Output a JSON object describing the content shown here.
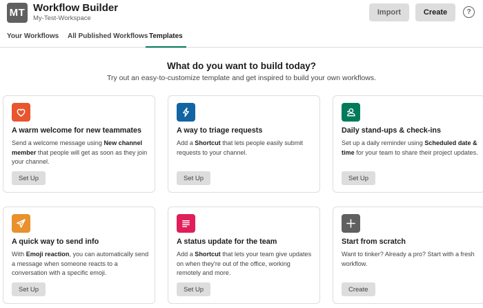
{
  "header": {
    "avatar_text": "MT",
    "title": "Workflow Builder",
    "workspace": "My-Test-Workspace",
    "import_label": "Import",
    "create_label": "Create",
    "help_label": "?"
  },
  "tabs": [
    {
      "label": "Your Workflows"
    },
    {
      "label": "All Published Workflows"
    },
    {
      "label": "Templates",
      "active": true
    }
  ],
  "hero": {
    "title": "What do you want to build today?",
    "subtitle": "Try out an easy-to-customize template and get inspired to build your own workflows."
  },
  "cards": [
    {
      "icon": "heart-icon",
      "icon_color": "#e8552e",
      "title": "A warm welcome for new teammates",
      "desc": [
        {
          "text": "Send a welcome message using "
        },
        {
          "text": "New channel member",
          "bold": true
        },
        {
          "text": " that people will get as soon as they join your channel."
        }
      ],
      "button": "Set Up"
    },
    {
      "icon": "lightning-icon",
      "icon_color": "#1264a3",
      "title": "A way to triage requests",
      "desc": [
        {
          "text": "Add a "
        },
        {
          "text": "Shortcut",
          "bold": true
        },
        {
          "text": " that lets people easily submit requests to your channel."
        }
      ],
      "button": "Set Up"
    },
    {
      "icon": "standup-icon",
      "icon_color": "#007a5a",
      "title": "Daily stand-ups & check-ins",
      "desc": [
        {
          "text": "Set up a daily reminder using "
        },
        {
          "text": "Scheduled date & time",
          "bold": true
        },
        {
          "text": " for your team to share their project updates."
        }
      ],
      "button": "Set Up"
    },
    {
      "icon": "paper-plane-icon",
      "icon_color": "#e8912d",
      "title": "A quick way to send info",
      "desc": [
        {
          "text": "With "
        },
        {
          "text": "Emoji reaction",
          "bold": true
        },
        {
          "text": ", you can automatically send a message when someone reacts to a conversation with a specific emoji."
        }
      ],
      "button": "Set Up"
    },
    {
      "icon": "list-icon",
      "icon_color": "#e01e5a",
      "title": "A status update for the team",
      "desc": [
        {
          "text": "Add a "
        },
        {
          "text": "Shortcut",
          "bold": true
        },
        {
          "text": " that lets your team give updates on when they're out of the office, working remotely and more."
        }
      ],
      "button": "Set Up"
    },
    {
      "icon": "plus-icon",
      "icon_color": "#616061",
      "title": "Start from scratch",
      "desc": [
        {
          "text": "Want to tinker? Already a pro? Start with a fresh workflow."
        }
      ],
      "button": "Create"
    }
  ]
}
